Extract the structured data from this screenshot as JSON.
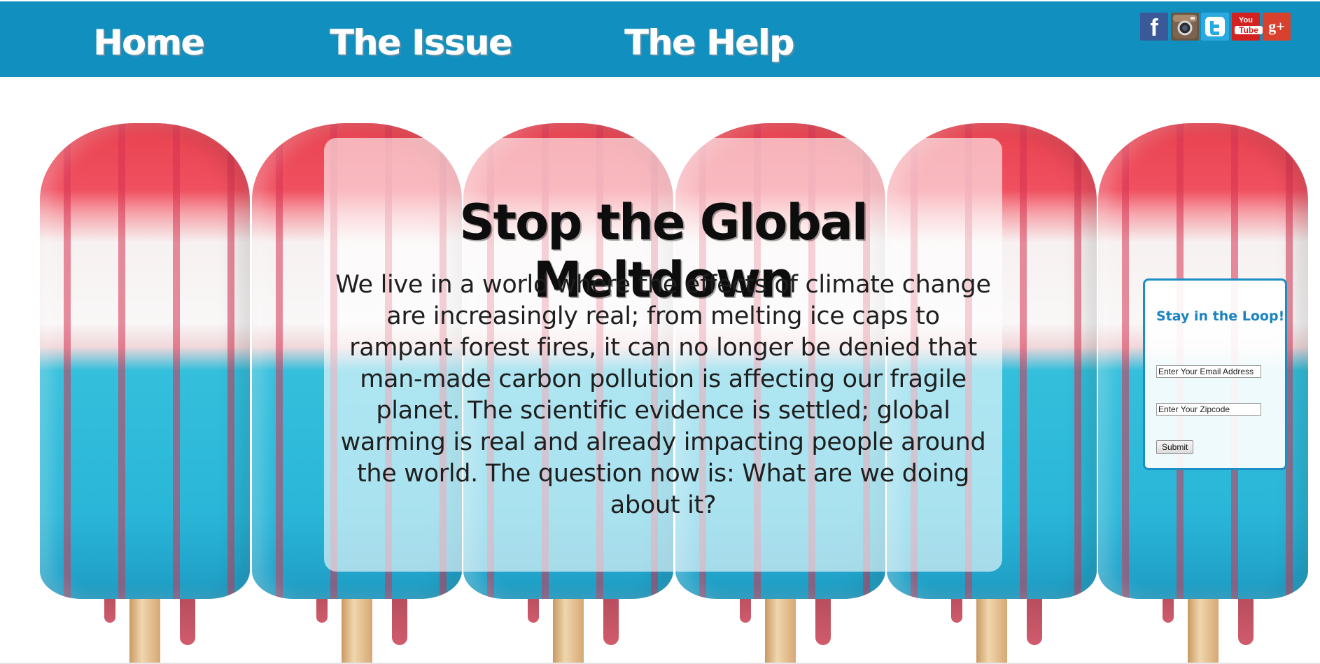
{
  "nav": {
    "items": [
      {
        "label": "Home"
      },
      {
        "label": "The Issue"
      },
      {
        "label": "The Help"
      }
    ],
    "bar_color": "#1190c0"
  },
  "social": [
    {
      "name": "facebook-icon",
      "glyph": "f"
    },
    {
      "name": "instagram-icon",
      "glyph": ""
    },
    {
      "name": "twitter-icon",
      "glyph": ""
    },
    {
      "name": "youtube-icon",
      "glyph_top": "You",
      "glyph_bottom": "Tube"
    },
    {
      "name": "google-plus-icon",
      "glyph": "g+"
    }
  ],
  "main": {
    "headline": "Stop the Global Meltdown",
    "body": "We live in a world where the effects of climate change are increasingly real; from melting ice caps to rampant forest fires, it can no longer be denied that man-made carbon pollution is affecting our fragile planet. The scientific evidence is settled; global warming is real and already impacting people around the world. The question now is: What are we doing about it?"
  },
  "signup": {
    "title": "Stay in the Loop!",
    "email_value": "Enter Your Email Address",
    "zip_value": "Enter Your Zipcode",
    "submit_label": "Submit"
  },
  "colors": {
    "accent": "#1b84c0",
    "popsicle_red": "#e9424f",
    "popsicle_blue": "#2ab6d8"
  }
}
